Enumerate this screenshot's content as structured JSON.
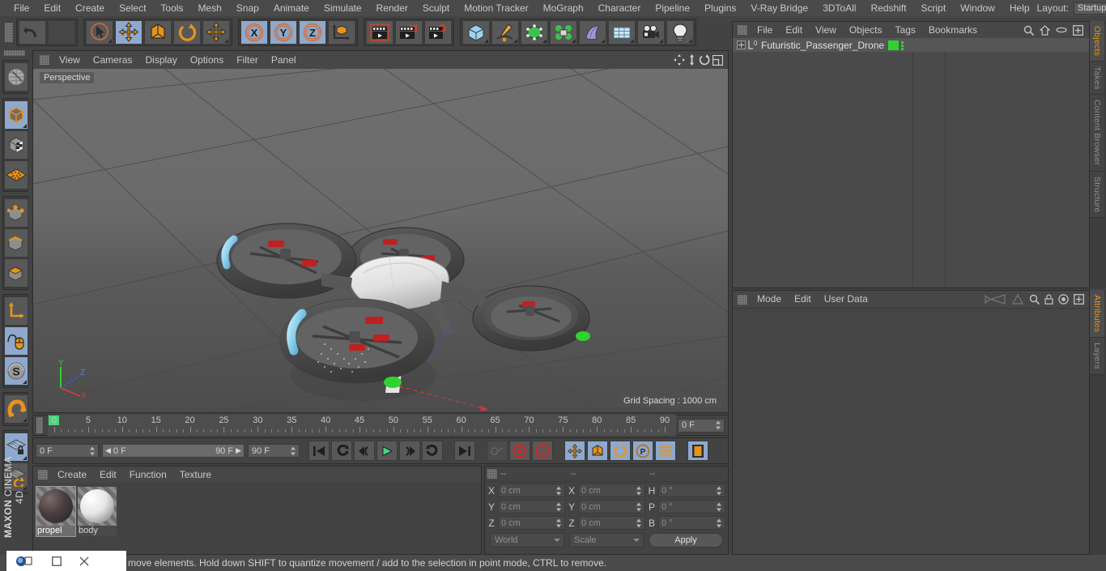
{
  "app": {
    "brand_top": "MAXON",
    "brand_bottom": "CINEMA 4D"
  },
  "menubar": {
    "items": [
      "File",
      "Edit",
      "Create",
      "Select",
      "Tools",
      "Mesh",
      "Snap",
      "Animate",
      "Simulate",
      "Render",
      "Sculpt",
      "Motion Tracker",
      "MoGraph",
      "Character",
      "Pipeline",
      "Plugins",
      "V-Ray Bridge",
      "3DToAll",
      "Redshift",
      "Script",
      "Window",
      "Help"
    ],
    "layout_label": "Layout:",
    "layout_value": "Startup",
    "search_icon": "search-icon"
  },
  "toolbar": {
    "groups": [
      {
        "name": "undo-redo",
        "buttons": [
          {
            "name": "undo-button",
            "icon": "undo-arrow-icon",
            "state": "normal"
          },
          {
            "name": "redo-button",
            "icon": "redo-arrow-icon",
            "state": "disabled"
          }
        ]
      },
      {
        "name": "transform-tools",
        "buttons": [
          {
            "name": "live-selection-tool",
            "icon": "cursor-circle-icon",
            "state": "normal"
          },
          {
            "name": "move-tool",
            "icon": "move-arrows-icon",
            "state": "active"
          },
          {
            "name": "scale-tool",
            "icon": "scale-box-icon",
            "state": "normal"
          },
          {
            "name": "rotate-tool",
            "icon": "rotate-circle-icon",
            "state": "normal"
          },
          {
            "name": "move-alt-tool",
            "icon": "move-arrows-icon",
            "state": "normal"
          }
        ]
      },
      {
        "name": "axis-locks",
        "buttons": [
          {
            "name": "x-axis-lock",
            "icon": "x-axis-icon",
            "label": "X",
            "state": "active"
          },
          {
            "name": "y-axis-lock",
            "icon": "y-axis-icon",
            "label": "Y",
            "state": "active"
          },
          {
            "name": "z-axis-lock",
            "icon": "z-axis-icon",
            "label": "Z",
            "state": "active"
          },
          {
            "name": "world-object-coord",
            "icon": "coordinate-cube-icon",
            "state": "normal"
          }
        ]
      },
      {
        "name": "render-tools",
        "buttons": [
          {
            "name": "render-view-button",
            "icon": "clapperboard-icon",
            "state": "normal"
          },
          {
            "name": "render-to-picture-viewer-button",
            "icon": "clapperboard-window-icon",
            "state": "normal"
          },
          {
            "name": "render-settings-button",
            "icon": "clapperboard-gear-icon",
            "state": "normal"
          }
        ]
      },
      {
        "name": "create-objects",
        "buttons": [
          {
            "name": "add-cube-button",
            "icon": "blue-cube-icon",
            "state": "normal"
          },
          {
            "name": "add-spline-button",
            "icon": "pen-spline-icon",
            "state": "normal"
          },
          {
            "name": "add-generator-button",
            "icon": "green-cube-nurbs-icon",
            "state": "normal"
          },
          {
            "name": "add-array-button",
            "icon": "green-cluster-icon",
            "state": "normal"
          },
          {
            "name": "add-deformer-button",
            "icon": "purple-bend-icon",
            "state": "normal"
          },
          {
            "name": "add-environment-button",
            "icon": "grid-floor-icon",
            "state": "normal"
          },
          {
            "name": "add-camera-button",
            "icon": "camera-icon",
            "state": "normal"
          },
          {
            "name": "add-light-button",
            "icon": "lightbulb-icon",
            "state": "normal"
          }
        ]
      }
    ]
  },
  "left_rail": {
    "groups": [
      [
        {
          "name": "texture-axis-tool",
          "icon": "globe-wireframe-icon",
          "state": "normal"
        }
      ],
      [
        {
          "name": "model-mode-button",
          "icon": "cube-outline-icon",
          "state": "active"
        },
        {
          "name": "texture-mode-button",
          "icon": "checker-cube-icon",
          "state": "normal"
        },
        {
          "name": "points-grid-button",
          "icon": "orange-mesh-icon",
          "state": "normal"
        }
      ],
      [
        {
          "name": "point-mode-button",
          "icon": "cube-points-icon",
          "state": "normal"
        },
        {
          "name": "edge-mode-button",
          "icon": "cube-edges-icon",
          "state": "normal"
        },
        {
          "name": "polygon-mode-button",
          "icon": "cube-polygon-icon",
          "state": "normal"
        }
      ],
      [
        {
          "name": "axis-mode-button",
          "icon": "axis-l-icon",
          "state": "normal"
        },
        {
          "name": "viewport-solo-button",
          "icon": "mouse-spline-icon",
          "state": "active"
        },
        {
          "name": "soft-selection-button",
          "icon": "s-sphere-icon",
          "state": "active"
        }
      ],
      [
        {
          "name": "magnet-tool-button",
          "icon": "magnet-icon",
          "state": "normal"
        }
      ],
      [
        {
          "name": "lock-workplane-button",
          "icon": "grid-lock-icon",
          "state": "active"
        },
        {
          "name": "workplane-rotate-button",
          "icon": "grid-rotate-icon",
          "state": "normal"
        }
      ]
    ]
  },
  "viewport": {
    "menu": [
      "View",
      "Cameras",
      "Display",
      "Options",
      "Filter",
      "Panel"
    ],
    "perspective_tag": "Perspective",
    "grid_spacing": "Grid Spacing : 1000 cm",
    "axis_labels": {
      "x": "X",
      "y": "Y",
      "z": "Z"
    },
    "nav_icons": [
      "pan-icon",
      "dolly-icon",
      "orbit-icon",
      "maximize-viewport-icon"
    ],
    "colors": {
      "body_white": "#e8e8e8",
      "rotor_dark": "#4a4a4a",
      "led_cyan": "#7ec8e8",
      "led_green": "#2fd32f",
      "led_red": "#cf2020"
    }
  },
  "timeline": {
    "ruler_labels": [
      "0",
      "5",
      "10",
      "15",
      "20",
      "25",
      "30",
      "35",
      "40",
      "45",
      "50",
      "55",
      "60",
      "65",
      "70",
      "75",
      "80",
      "85",
      "90"
    ],
    "ruler_min": 0,
    "ruler_max": 90,
    "current_frame_marker": "0",
    "right_field_value": "0 F"
  },
  "transport": {
    "current_frame": "0 F",
    "range_start": "0 F",
    "range_end": "90 F",
    "end_field": "90 F",
    "buttons": [
      {
        "name": "go-to-start-button",
        "icon": "skip-start-icon",
        "state": "normal"
      },
      {
        "name": "previous-key-button",
        "icon": "rewind-loop-icon",
        "state": "normal"
      },
      {
        "name": "step-back-button",
        "icon": "step-back-icon",
        "state": "normal"
      },
      {
        "name": "play-button",
        "icon": "play-icon",
        "state": "normal"
      },
      {
        "name": "step-forward-button",
        "icon": "step-forward-icon",
        "state": "normal"
      },
      {
        "name": "next-key-button",
        "icon": "forward-loop-icon",
        "state": "normal"
      },
      {
        "name": "go-to-end-button",
        "icon": "skip-end-icon",
        "state": "normal"
      },
      {
        "name": "record-active-objects-button",
        "icon": "key-icon",
        "state": "disabled"
      },
      {
        "name": "record-button",
        "icon": "record-circle-icon",
        "state": "normal"
      },
      {
        "name": "autokeying-button",
        "icon": "question-circle-icon",
        "state": "normal"
      },
      {
        "name": "position-key-button",
        "icon": "move-arrows-icon",
        "state": "active"
      },
      {
        "name": "scale-key-button",
        "icon": "scale-box-icon",
        "state": "active"
      },
      {
        "name": "rotation-key-button",
        "icon": "rotate-circle-icon",
        "state": "active"
      },
      {
        "name": "parameter-key-button",
        "icon": "p-circle-icon",
        "state": "active"
      },
      {
        "name": "pla-key-button",
        "icon": "dot-grid-icon",
        "state": "active"
      },
      {
        "name": "timeline-toggle-button",
        "icon": "film-strip-icon",
        "state": "active"
      }
    ]
  },
  "material_manager": {
    "menu": [
      "Create",
      "Edit",
      "Function",
      "Texture"
    ],
    "materials": [
      {
        "name": "propel",
        "color": "#4a3f40",
        "selected": true
      },
      {
        "name": "body",
        "color": "#e6e6e6",
        "selected": false
      }
    ]
  },
  "coordinates": {
    "headers": [
      "--",
      "--",
      "--"
    ],
    "rows": [
      {
        "pos_label": "X",
        "pos_value": "0 cm",
        "size_label": "X",
        "size_value": "0 cm",
        "rot_label": "H",
        "rot_value": "0 °"
      },
      {
        "pos_label": "Y",
        "pos_value": "0 cm",
        "size_label": "Y",
        "size_value": "0 cm",
        "rot_label": "P",
        "rot_value": "0 °"
      },
      {
        "pos_label": "Z",
        "pos_value": "0 cm",
        "size_label": "Z",
        "size_value": "0 cm",
        "rot_label": "B",
        "rot_value": "0 °"
      }
    ],
    "coord_system": "World",
    "size_mode": "Scale",
    "apply_label": "Apply"
  },
  "object_manager": {
    "menu": [
      "File",
      "Edit",
      "View",
      "Objects",
      "Tags",
      "Bookmarks"
    ],
    "icons": [
      "search-icon",
      "home-icon",
      "ellipse-icon",
      "fit-icon"
    ],
    "objects": [
      {
        "name": "Futuristic_Passenger_Drone",
        "level_badge": "0",
        "tag_color": "#2fd32f",
        "selected": true
      }
    ]
  },
  "attributes": {
    "menu": [
      "Mode",
      "Edit",
      "User Data"
    ],
    "icons": [
      "nav-back-icon",
      "nav-up-icon",
      "search-icon",
      "lock-icon",
      "target-icon",
      "fit-icon"
    ]
  },
  "right_tabs_top": [
    {
      "label": "Objects",
      "active": true
    },
    {
      "label": "Takes",
      "active": false
    },
    {
      "label": "Content Browser",
      "active": false
    },
    {
      "label": "Structure",
      "active": false
    }
  ],
  "right_tabs_bottom": [
    {
      "label": "Attributes",
      "active": true
    },
    {
      "label": "Layers",
      "active": false
    }
  ],
  "status": {
    "message": "move elements. Hold down SHIFT to quantize movement / add to the selection in point mode, CTRL to remove."
  },
  "taskbar": {
    "items": [
      "app-icon",
      "minimize-icon",
      "maximize-icon",
      "close-icon"
    ]
  }
}
